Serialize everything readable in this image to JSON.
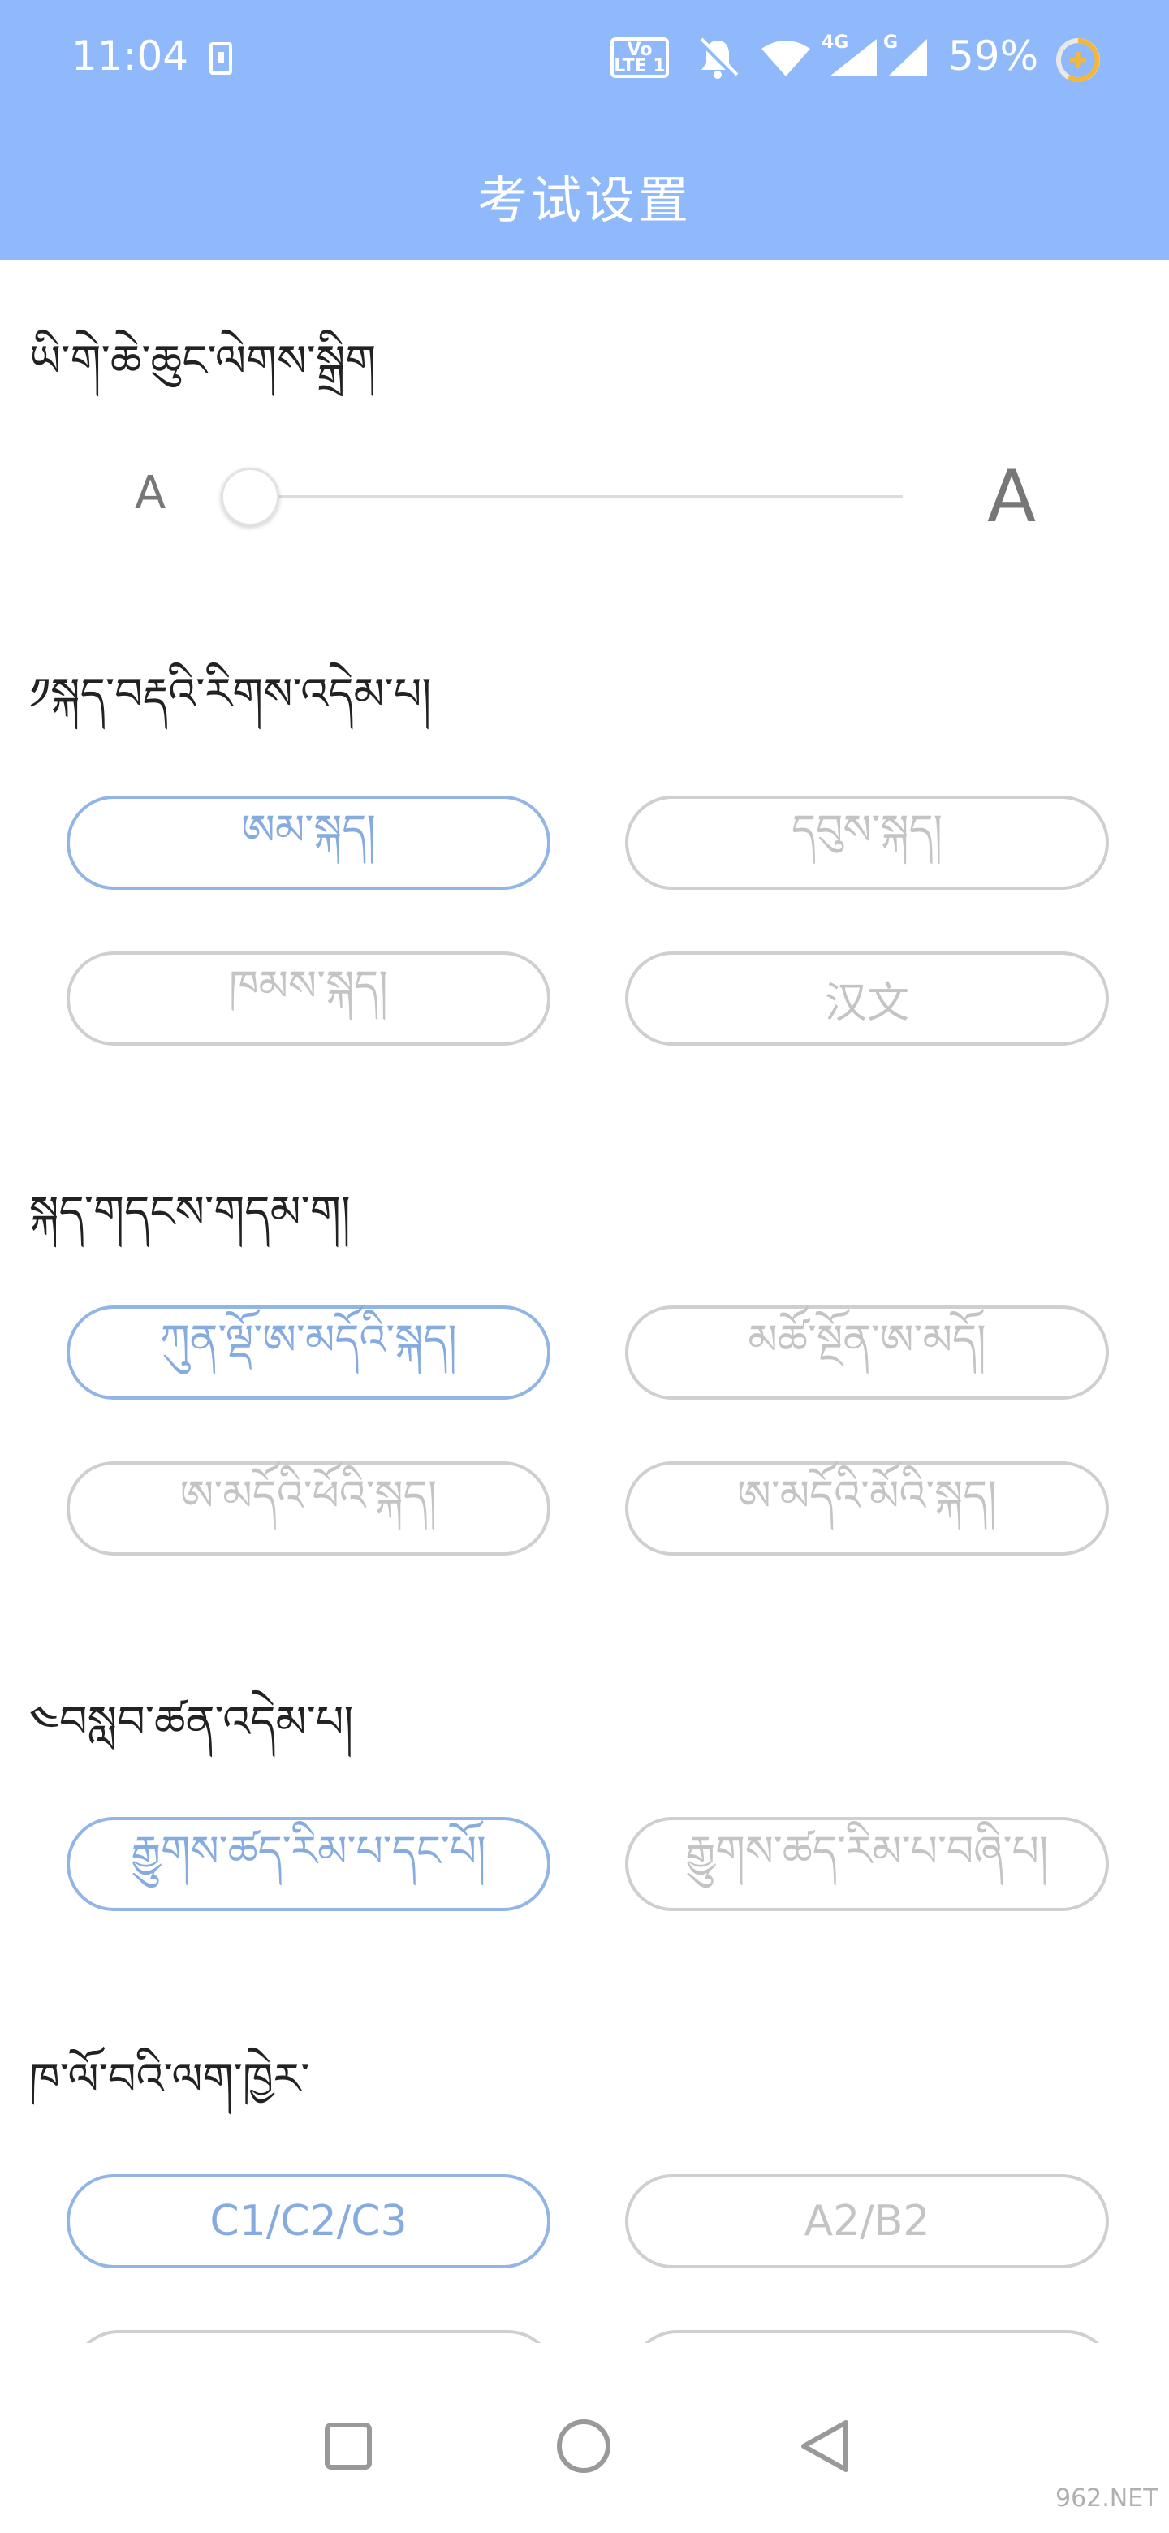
{
  "status_bar": {
    "time": "11:04",
    "volte_label": "Vo LTE 1",
    "tag_4g": "4G",
    "tag_g": "G",
    "battery_percent": "59%",
    "icons": [
      "download-icon",
      "volte-icon",
      "bell-off-icon",
      "wifi-icon",
      "signal-icon",
      "signal-icon",
      "battery-saver-icon"
    ]
  },
  "header": {
    "title": "考试设置"
  },
  "font_size": {
    "title": "ཡི་གེ་ཆེ་ཆུང་ལེགས་སྒྲིག",
    "small_label": "A",
    "large_label": "A",
    "level": 0
  },
  "language": {
    "title": "༡སྐད་བརྡའི་རིགས་འདེམ་པ།",
    "options": [
      {
        "label": "ཨམ་སྐད།",
        "selected": true
      },
      {
        "label": "དབུས་སྐད།",
        "selected": false
      },
      {
        "label": "ཁམས་སྐད།",
        "selected": false
      },
      {
        "label": "汉文",
        "selected": false
      }
    ]
  },
  "voice": {
    "title": "སྐད་གདངས་གདམ་ག།",
    "options": [
      {
        "label": "ཀུན་ལྡོ་ཨ་མདོའི་སྐད།",
        "selected": true
      },
      {
        "label": "མཚོ་སྔོན་ཨ་མདོ།",
        "selected": false
      },
      {
        "label": "ཨ་མདོའི་ཕོའི་སྐད།",
        "selected": false
      },
      {
        "label": "ཨ་མདོའི་མོའི་སྐད།",
        "selected": false
      }
    ]
  },
  "exam_subject": {
    "title": "༤བསླབ་ཚན་འདེམ་པ།",
    "options": [
      {
        "label": "རྒྱུགས་ཚད་རིམ་པ་དང་པོ།",
        "selected": true
      },
      {
        "label": "རྒྱུགས་ཚད་རིམ་པ་བཞི་པ།",
        "selected": false
      }
    ]
  },
  "license_type": {
    "title": "ཁ་ལོ་བའི་ལག་ཁྱེར་",
    "options": [
      {
        "label": "C1/C2/C3",
        "selected": true
      },
      {
        "label": "A2/B2",
        "selected": false
      }
    ]
  },
  "watermark": "962.NET",
  "colors": {
    "header_bg": "#8fb9fb",
    "selected_border": "#91b6e6",
    "selected_text": "#86acdf",
    "unselected_border": "#cfcfcf",
    "unselected_text": "#c4c4c4"
  }
}
